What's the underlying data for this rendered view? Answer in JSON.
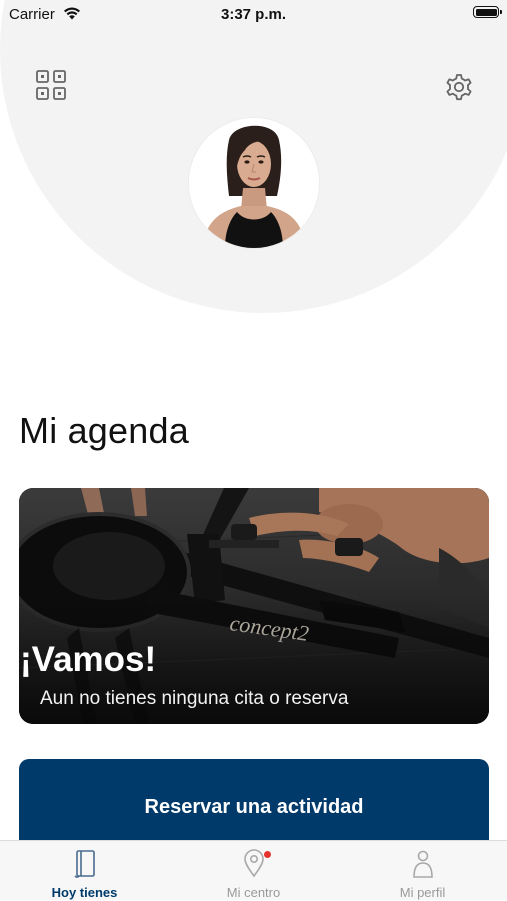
{
  "status_bar": {
    "carrier": "Carrier",
    "time": "3:37 p.m."
  },
  "header": {
    "qr_icon": "qr-code-icon",
    "settings_icon": "gear-icon",
    "background_color": "#f3f3f3"
  },
  "agenda": {
    "title": "Mi agenda",
    "card": {
      "title": "¡Vamos!",
      "subtitle": "Aun no tienes ninguna cita o reserva",
      "brand_text": "concept2"
    }
  },
  "cta": {
    "label": "Reservar una actividad",
    "color": "#003a6b"
  },
  "tab_bar": {
    "items": [
      {
        "label": "Hoy tienes",
        "icon": "notebook-icon",
        "active": true
      },
      {
        "label": "Mi centro",
        "icon": "location-pin-icon",
        "badge": true
      },
      {
        "label": "Mi perfil",
        "icon": "person-icon"
      }
    ],
    "active_color": "#003a6b",
    "inactive_color": "#9a9a9a",
    "badge_color": "#e5322d"
  }
}
